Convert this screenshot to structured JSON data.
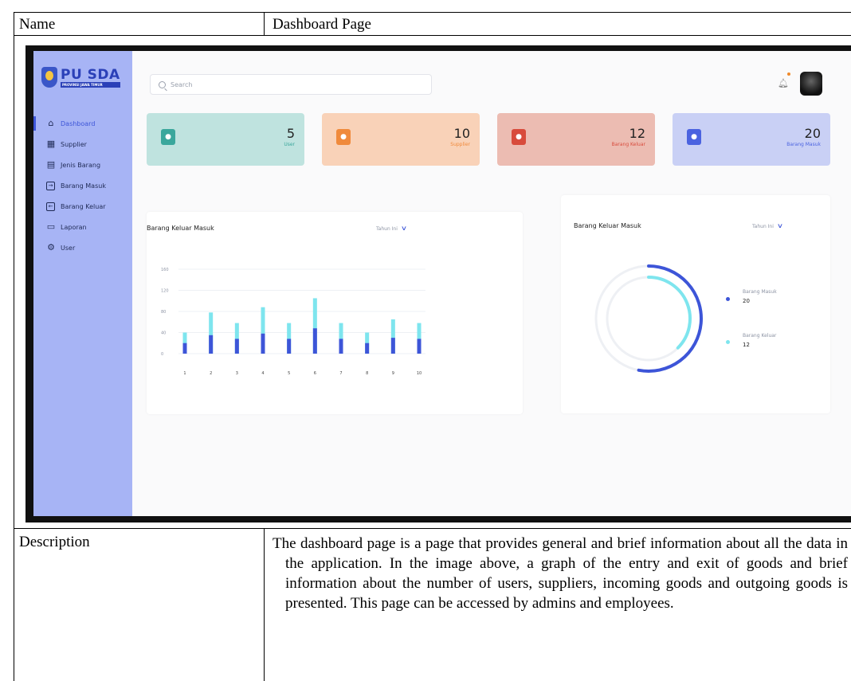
{
  "doc": {
    "name_label": "Name",
    "name_value": "Dashboard Page",
    "desc_label": "Description",
    "desc_value": "The dashboard page is a page that provides general and brief information about all the data in the application. In the image above, a graph of the entry and exit of goods and brief information about the number of users, suppliers, incoming goods and outgoing goods is presented. This page can be accessed by admins and employees."
  },
  "app": {
    "logo": {
      "title": "PU SDA",
      "subtitle": "PROVINSI JAWA TIMUR"
    },
    "nav": [
      {
        "label": "Dashboard",
        "icon": "home-icon",
        "active": true
      },
      {
        "label": "Supplier",
        "icon": "building-icon"
      },
      {
        "label": "Jenis Barang",
        "icon": "boxes-icon"
      },
      {
        "label": "Barang Masuk",
        "icon": "arrow-in-icon"
      },
      {
        "label": "Barang Keluar",
        "icon": "arrow-out-icon"
      },
      {
        "label": "Laporan",
        "icon": "report-icon"
      },
      {
        "label": "User",
        "icon": "gear-icon"
      }
    ],
    "search": {
      "placeholder": "Search"
    },
    "cards": [
      {
        "value": "5",
        "label": "User",
        "bg": "#bfe3df",
        "icon_bg": "#3aa79c",
        "label_color": "#3aa79c"
      },
      {
        "value": "10",
        "label": "Supplier",
        "bg": "#f9d2b8",
        "icon_bg": "#f08a3c",
        "label_color": "#f08a3c"
      },
      {
        "value": "12",
        "label": "Barang Keluar",
        "bg": "#ecbcb2",
        "icon_bg": "#d84b3c",
        "label_color": "#d84b3c"
      },
      {
        "value": "20",
        "label": "Barang Masuk",
        "bg": "#c9d0f5",
        "icon_bg": "#4b63e0",
        "label_color": "#4b63e0"
      }
    ],
    "bar_panel": {
      "title": "Barang Keluar Masuk",
      "filter": "Tahun Ini"
    },
    "donut_panel": {
      "title": "Barang Keluar Masuk",
      "filter": "Tahun Ini",
      "legend": [
        {
          "label": "Barang Masuk",
          "value": "20",
          "color": "#3d55d8"
        },
        {
          "label": "Barang Keluar",
          "value": "12",
          "color": "#7ee5ee"
        }
      ]
    }
  },
  "chart_data": [
    {
      "type": "bar",
      "title": "Barang Keluar Masuk",
      "categories": [
        "1",
        "2",
        "3",
        "4",
        "5",
        "6",
        "7",
        "8",
        "9",
        "10"
      ],
      "yticks": [
        "160",
        "120",
        "80",
        "40",
        "0"
      ],
      "ylim": [
        0,
        160
      ],
      "series": [
        {
          "values": [
            40,
            78,
            58,
            88,
            58,
            105,
            58,
            40,
            65,
            58
          ],
          "color": "#7ee5ee"
        },
        {
          "values": [
            20,
            35,
            28,
            38,
            28,
            48,
            28,
            20,
            30,
            28
          ],
          "color": "#3d55d8"
        }
      ]
    },
    {
      "type": "pie",
      "title": "Barang Keluar Masuk",
      "series": [
        {
          "name": "Barang Masuk",
          "values": [
            20
          ],
          "color": "#3d55d8"
        },
        {
          "name": "Barang Keluar",
          "values": [
            12
          ],
          "color": "#7ee5ee"
        }
      ]
    }
  ]
}
